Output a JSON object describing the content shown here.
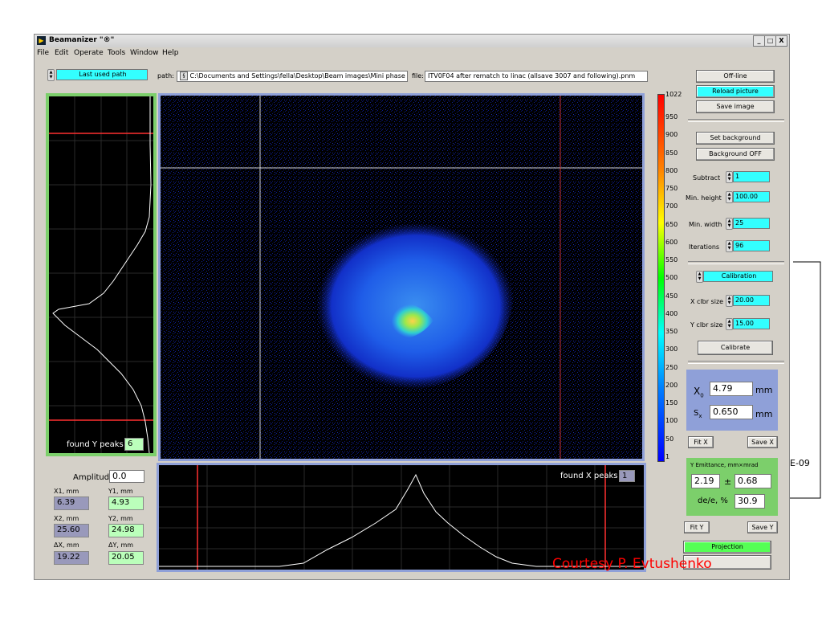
{
  "slide": {
    "background_title_fragment": "",
    "courtesy": "Courtesy P. Evtushenko",
    "outside_label": "E-09"
  },
  "window": {
    "title": "Beamanizer \"®\"",
    "icon": "labview-app-icon",
    "controls": [
      "_",
      "□",
      "X"
    ]
  },
  "menu": [
    "File",
    "Edit",
    "Operate",
    "Tools",
    "Window",
    "Help"
  ],
  "toolbar": {
    "path_mode": "Last used path",
    "path_label": "path:",
    "path_value": "C:\\Documents and Settings\\fella\\Desktop\\Beam images\\Mini phase",
    "file_label": "file:",
    "file_value": "ITV0F04 after rematch to linac (allsave 3007 and following).pnm"
  },
  "buttons": {
    "offline": "Off-line",
    "reload": "Reload picture",
    "save_image": "Save image",
    "set_background": "Set background",
    "background_off": "Background OFF",
    "calibration": "Calibration",
    "calibrate": "Calibrate",
    "fit_x": "Fit X",
    "save_x": "Save X",
    "fit_y": "Fit Y",
    "save_y": "Save Y",
    "projection": "Projection"
  },
  "params": [
    {
      "label": "Subtract",
      "value": "1"
    },
    {
      "label": "Min. height",
      "value": "100.00"
    },
    {
      "label": "Min. width",
      "value": "25"
    },
    {
      "label": "Iterations",
      "value": "96"
    }
  ],
  "calib": [
    {
      "label": "X clbr size",
      "value": "20.00"
    },
    {
      "label": "Y clbr size",
      "value": "15.00"
    }
  ],
  "fit": {
    "x0_label": "X",
    "x0_sub": "0",
    "x0_value": "4.79",
    "x0_unit": "mm",
    "sx_label": "S",
    "sx_sub": "x",
    "sx_value": "0.650",
    "sx_unit": "mm"
  },
  "emittance": {
    "title": "Y Emittance, mm×mrad",
    "value": "2.19",
    "pm": "±",
    "error": "0.68",
    "de_label": "de/e, %",
    "de_value": "30.9"
  },
  "scale": {
    "ticks": [
      "1022",
      "950",
      "900",
      "850",
      "800",
      "750",
      "700",
      "650",
      "600",
      "550",
      "500",
      "450",
      "400",
      "350",
      "300",
      "250",
      "200",
      "150",
      "100",
      "50",
      "1"
    ]
  },
  "yprofile": {
    "peaks_label": "found Y peaks",
    "peaks_value": "6"
  },
  "xprofile": {
    "peaks_label": "found X peaks",
    "peaks_value": "1"
  },
  "measure": {
    "amplitude_label": "Amplitude",
    "amplitude_value": "0.0",
    "x1_label": "X1, mm",
    "x1_value": "6.39",
    "y1_label": "Y1, mm",
    "y1_value": "4.93",
    "x2_label": "X2, mm",
    "x2_value": "25.60",
    "y2_label": "Y2, mm",
    "y2_value": "24.98",
    "dx_label": "ΔX, mm",
    "dx_value": "19.22",
    "dy_label": "ΔY, mm",
    "dy_value": "20.05"
  },
  "colors": {
    "window_bg": "#d4d0c8",
    "cyan": "#33ffff",
    "plot_bg": "#000000",
    "marker_red": "#ff3030",
    "courtesy_red": "#ff0000"
  }
}
